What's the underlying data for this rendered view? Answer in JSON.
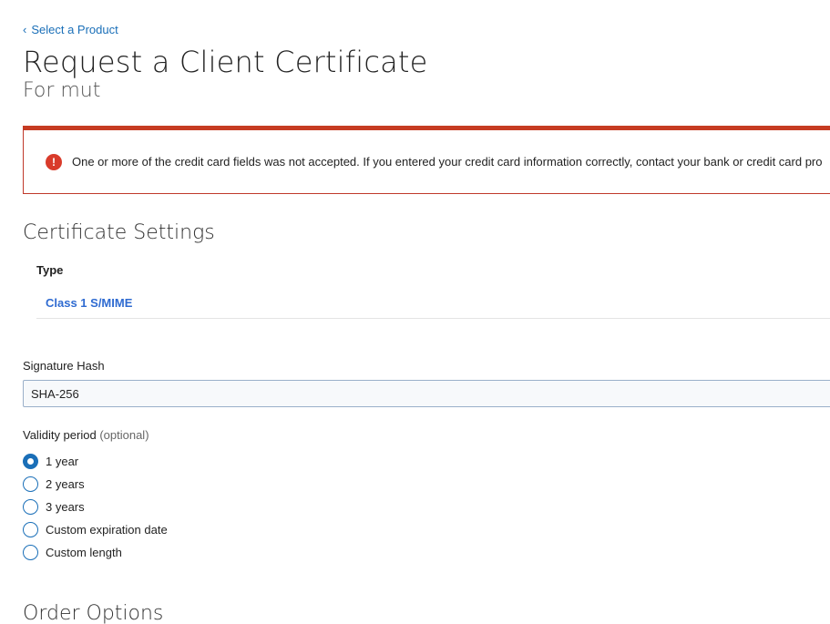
{
  "nav": {
    "back_label": "Select a Product"
  },
  "header": {
    "title": "Request a Client Certificate",
    "subtitle": "For mut"
  },
  "alert": {
    "icon": "exclamation-circle-icon",
    "color": "#c63b22",
    "message": "One or more of the credit card fields was not accepted. If you entered your credit card information correctly, contact your bank or credit card pro"
  },
  "certificate_settings": {
    "section_title": "Certificate Settings",
    "type_label": "Type",
    "type_value": "Class 1 S/MIME",
    "signature_hash_label": "Signature Hash",
    "signature_hash_value": "SHA-256",
    "validity_label": "Validity period",
    "validity_optional": "(optional)",
    "validity_options": [
      {
        "label": "1 year",
        "checked": true
      },
      {
        "label": "2 years",
        "checked": false
      },
      {
        "label": "3 years",
        "checked": false
      },
      {
        "label": "Custom expiration date",
        "checked": false
      },
      {
        "label": "Custom length",
        "checked": false
      }
    ]
  },
  "order_options": {
    "section_title": "Order Options"
  },
  "colors": {
    "accent": "#1a6fb8",
    "type_value": "#2f6bd1",
    "error": "#c63b22"
  }
}
